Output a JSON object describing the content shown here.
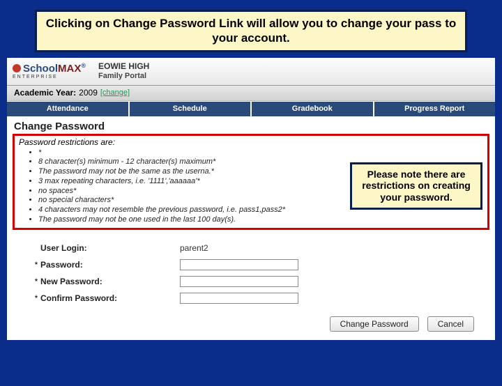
{
  "callouts": {
    "top": "Clicking on Change Password Link will allow you to change your pass to your account.",
    "side": "Please note there are restrictions on creating your password."
  },
  "header": {
    "logo_main": "Scho",
    "logo_emph1": "o",
    "logo_emph2": "l",
    "logo_max": "MAX",
    "logo_reg": "®",
    "logo_sub": "ENTERPRISE",
    "school_name": "EOWIE HIGH",
    "portal_label": "Family Portal"
  },
  "yearbar": {
    "label": "Academic Year:",
    "value": "2009",
    "change": "[change]"
  },
  "tabs": [
    "Attendance",
    "Schedule",
    "Gradebook",
    "Progress Report"
  ],
  "page": {
    "title": "Change Password",
    "restrictions_heading": "Password restrictions are:",
    "restrictions": [
      "*",
      "8 character(s) minimum - 12 character(s) maximum*",
      "The password may not be the same as the userna.*",
      "3 max repeating characters, i.e. '1111','aaaaaa'*",
      "no spaces*",
      "no special characters*",
      "4 characters may not resemble the previous password, i.e. pass1,pass2*",
      "The password may not be one used in the last 100 day(s)."
    ]
  },
  "form": {
    "user_login_label": "User Login:",
    "user_login_value": "parent2",
    "password_label": "Password:",
    "new_password_label": "New Password:",
    "confirm_password_label": "Confirm Password:"
  },
  "buttons": {
    "change": "Change Password",
    "cancel": "Cancel"
  }
}
